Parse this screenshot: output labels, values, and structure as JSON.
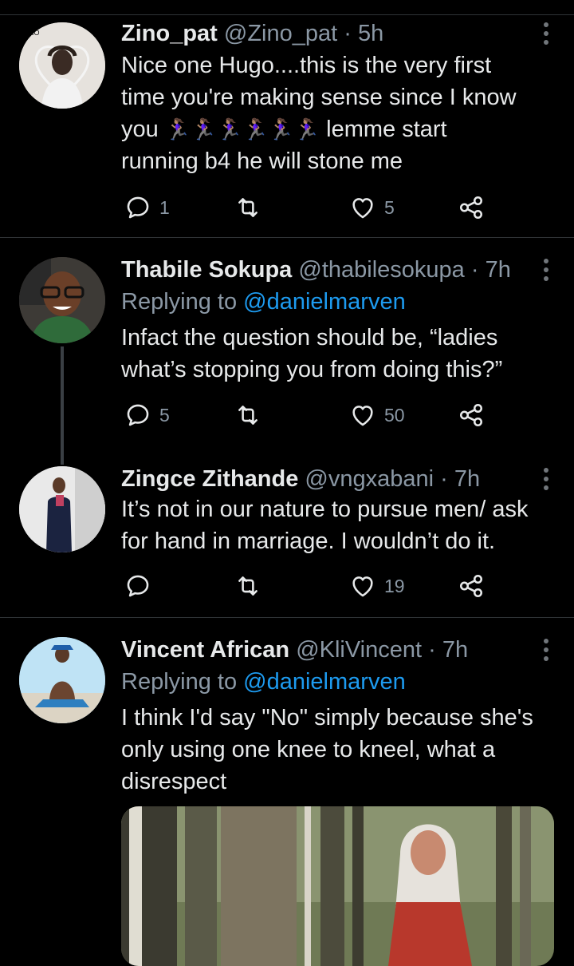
{
  "tweets": [
    {
      "name": "Zino_pat",
      "handle": "@Zino_pat · 5h",
      "text_line1": "Nice one Hugo....this is the very first",
      "text_line2": "time you're making sense since I know",
      "text_line3_start": "you",
      "runner_glyphs": "🏃🏽‍♀️🏃🏽‍♀️🏃🏽‍♀️🏃🏽‍♀️🏃🏽‍♀️🏃🏽‍♀️",
      "text_line3_end": "lemme start",
      "text_line4": "running b4 he will stone me",
      "replies": "1",
      "retweets": "",
      "likes": "5",
      "avatar_badge": "ZINO"
    },
    {
      "name": "Thabile Sokupa",
      "handle": "@thabilesokupa · 7h",
      "replying_label": "Replying to",
      "replying_to": "@danielmarven",
      "text_line1": "Infact the question should be, “ladies",
      "text_line2": "what’s stopping you from doing this?”",
      "replies": "5",
      "retweets": "",
      "likes": "50"
    },
    {
      "name": "Zingce Zithande",
      "handle": "@vngxabani · 7h",
      "text_line1": "It’s not in our nature to pursue men/ ask",
      "text_line2": "for hand in marriage. I wouldn’t do it.",
      "replies": "",
      "retweets": "",
      "likes": "19"
    },
    {
      "name": "Vincent African",
      "handle": "@KliVincent · 7h",
      "replying_label": "Replying to",
      "replying_to": "@danielmarven",
      "text_line1": "I think I'd say \"No\" simply because she's",
      "text_line2": "only using one knee to kneel, what a",
      "text_line3": "disrespect"
    }
  ],
  "colors": {
    "background": "#000000",
    "text": "#e7e9ea",
    "secondary": "#8b98a5",
    "link": "#1d9bf0",
    "divider": "#2f3336"
  }
}
